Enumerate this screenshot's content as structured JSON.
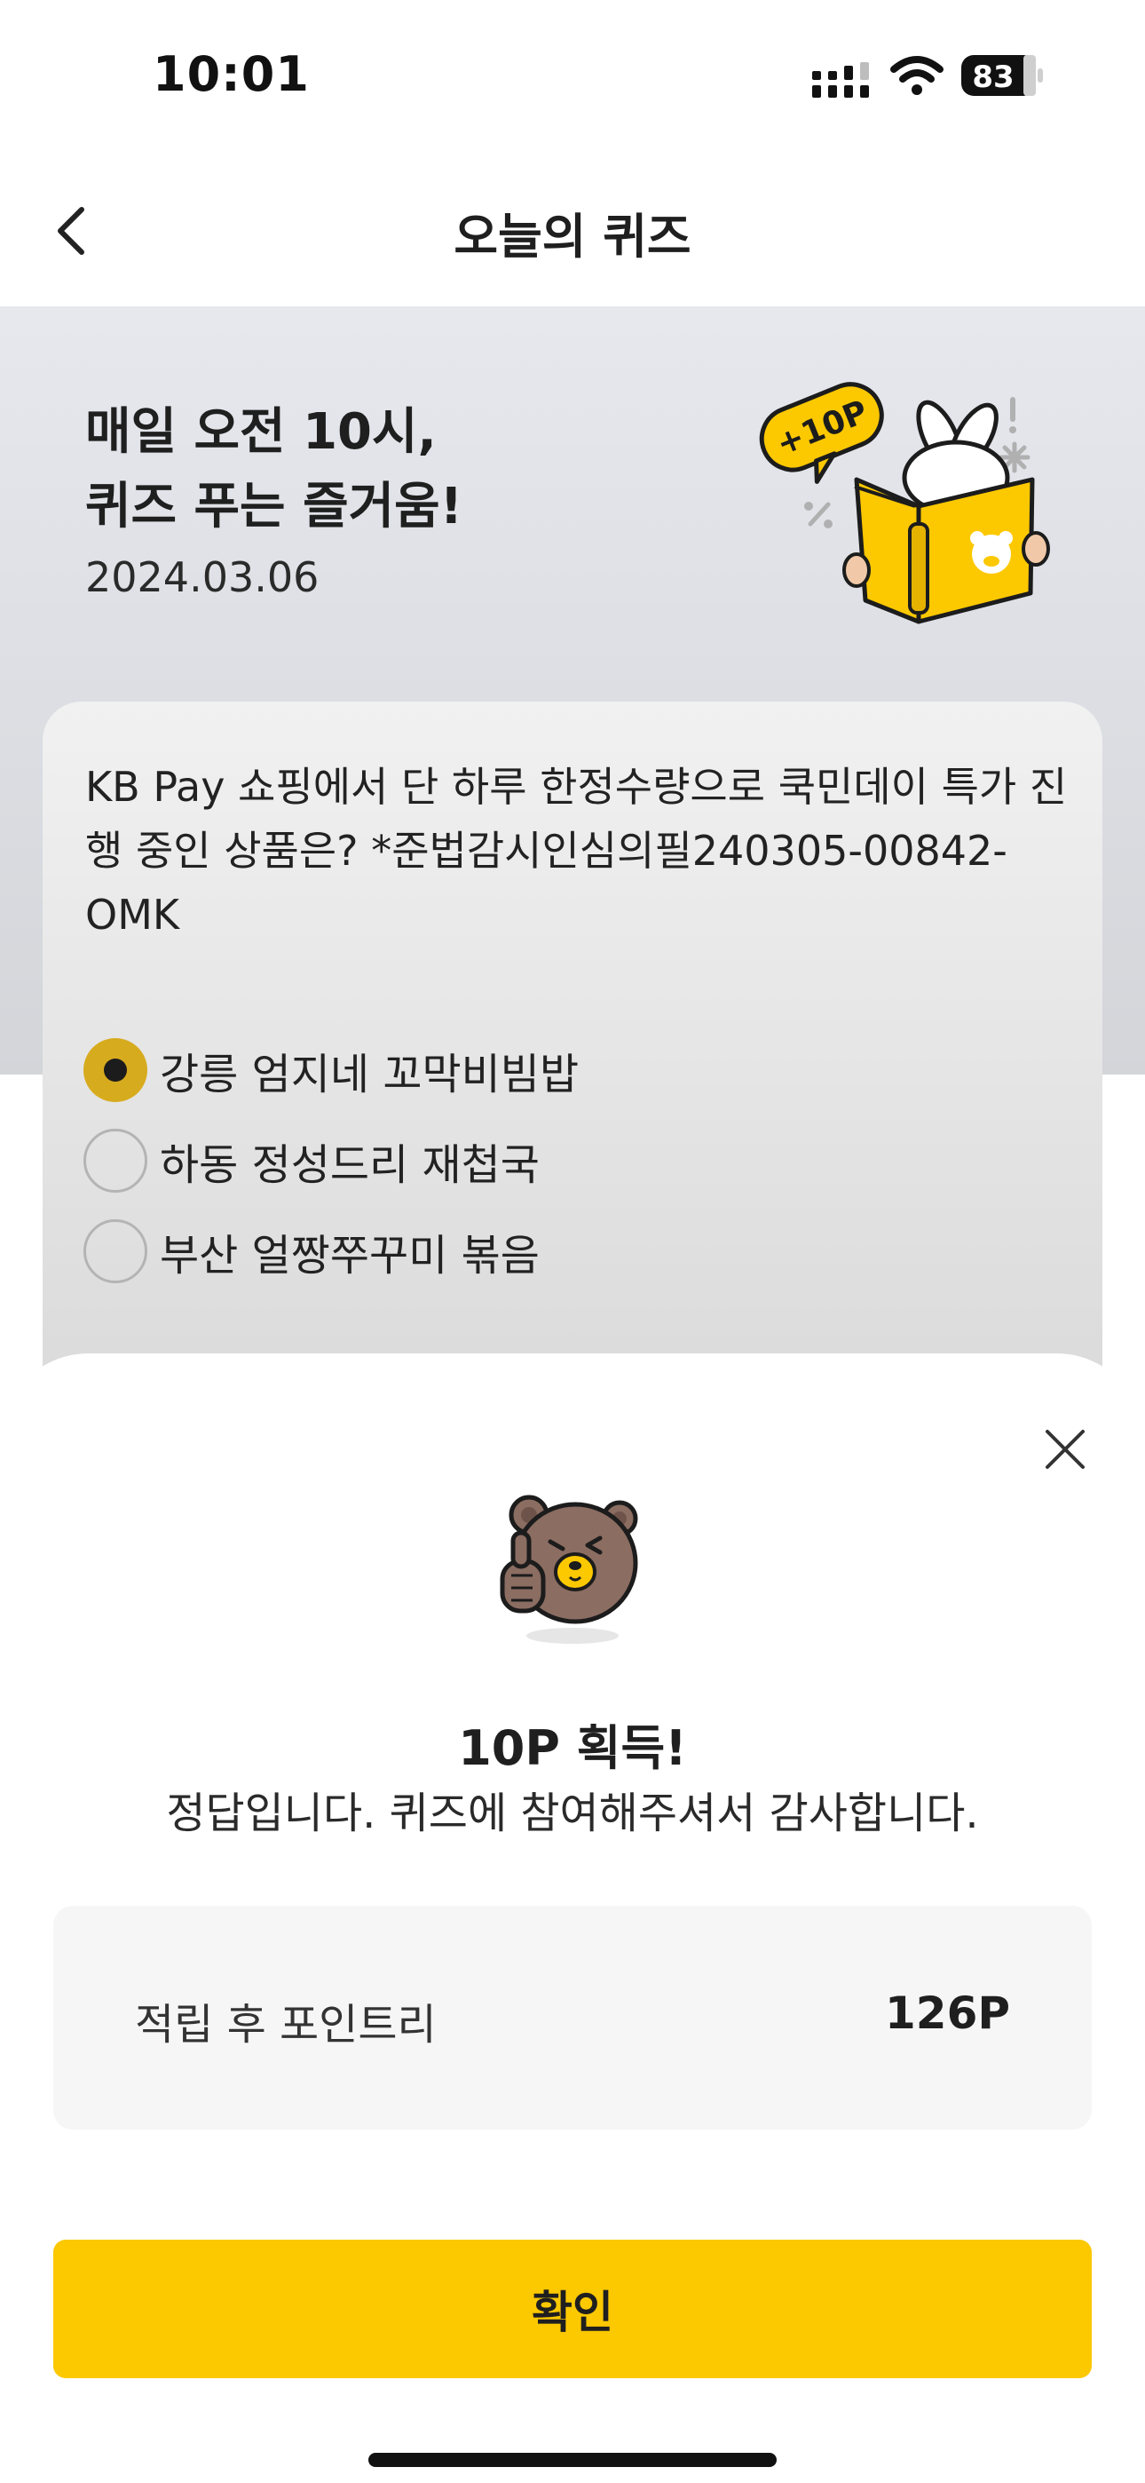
{
  "status_bar": {
    "time": "10:01",
    "battery": "83"
  },
  "header": {
    "title": "오늘의 퀴즈"
  },
  "hero": {
    "headline_line1": "매일 오전 10시,",
    "headline_line2": "퀴즈 푸는 즐거움!",
    "date": "2024.03.06",
    "badge": "+10P"
  },
  "quiz": {
    "question": "KB Pay 쇼핑에서 단 하루 한정수량으로 쿡민데이 특가 진행 중인 상품은? *준법감시인심의필240305-00842-OMK",
    "options": [
      {
        "label": "강릉 엄지네 꼬막비빔밥",
        "selected": true
      },
      {
        "label": "하동 정성드리 재첩국",
        "selected": false
      },
      {
        "label": "부산 얼짱쭈꾸미 볶음",
        "selected": false
      }
    ]
  },
  "result_sheet": {
    "title": "10P 획득!",
    "message": "정답입니다. 퀴즈에 참여해주셔서 감사합니다.",
    "points_label": "적립 후 포인트리",
    "points_value": "126P",
    "confirm_label": "확인"
  },
  "colors": {
    "accent_yellow": "#fcc800",
    "radio_selected": "#d7ab1e",
    "hero_background": "#e6e8ee"
  },
  "icons": [
    "signal-icon",
    "wifi-icon",
    "battery-icon",
    "back-icon",
    "reading-bunny-illustration",
    "close-icon",
    "thumbs-up-bear-icon"
  ]
}
